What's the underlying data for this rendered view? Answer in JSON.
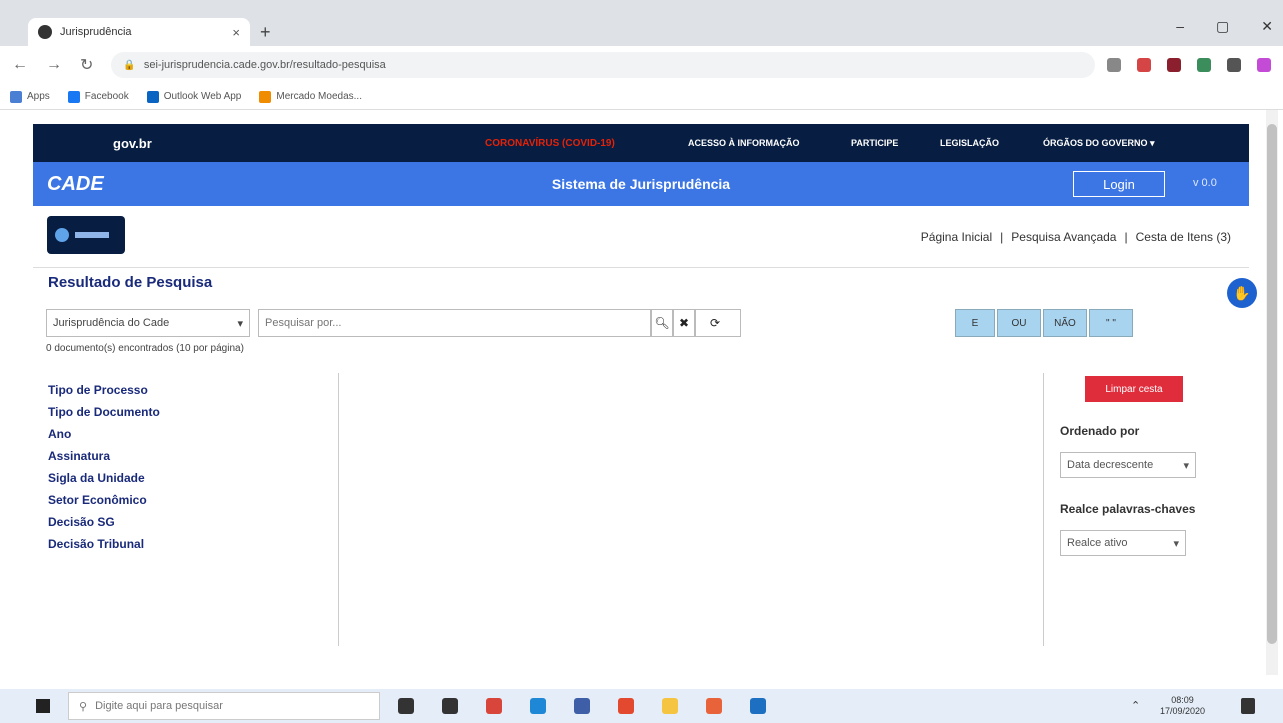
{
  "browser": {
    "tab_title": "Jurisprudência",
    "tab_close": "×",
    "new_tab": "+",
    "window_controls": [
      "–",
      "▢",
      "✕"
    ],
    "url": "sei-jurisprudencia.cade.gov.br/resultado-pesquisa",
    "bookmarks": [
      {
        "label": "Apps",
        "icon": "apps-grid-icon",
        "color": "#4a7fd4"
      },
      {
        "label": "Facebook",
        "icon": "facebook-icon",
        "color": "#1877f2"
      },
      {
        "label": "Outlook Web App",
        "icon": "outlook-icon",
        "color": "#0a64c2"
      },
      {
        "label": "Mercado Moedas...",
        "icon": "bookmark-icon",
        "color": "#f08c00"
      }
    ],
    "extensions": [
      {
        "icon": "star-icon",
        "color": "#888888"
      },
      {
        "icon": "pen-icon",
        "color": "#d64545"
      },
      {
        "icon": "stop-icon",
        "color": "#8b1f2d"
      },
      {
        "icon": "extension-icon",
        "color": "#3b8d5c"
      },
      {
        "icon": "puzzle-icon",
        "color": "#555555"
      },
      {
        "icon": "profile-icon",
        "color": "#c44bd6"
      }
    ]
  },
  "gov_bar": {
    "logo": "gov.br",
    "covid": "CORONAVÍRUS (COVID-19)",
    "links": [
      "ACESSO À INFORMAÇÃO",
      "PARTICIPE",
      "LEGISLAÇÃO",
      "ÓRGÃOS DO GOVERNO"
    ],
    "links_suffix": "▾"
  },
  "cade_bar": {
    "brand": "CADE",
    "system_title": "Sistema de Jurisprudência",
    "login_label": "Login",
    "version": "v 0.0"
  },
  "top_nav": {
    "items": [
      "Página Inicial",
      "Pesquisa Avançada",
      "Cesta de Itens (3)"
    ],
    "separator": "|"
  },
  "results": {
    "title": "Resultado de Pesquisa",
    "collection_selected": "Jurisprudência do Cade",
    "search_placeholder": "Pesquisar por...",
    "count_text": "0 documento(s) encontrados (10 por página)",
    "operator_buttons": [
      "E",
      "OU",
      "NÃO",
      "\" \""
    ]
  },
  "facets": [
    "Tipo de Processo",
    "Tipo de Documento",
    "Ano",
    "Assinatura",
    "Sigla da Unidade",
    "Setor Econômico",
    "Decisão SG",
    "Decisão Tribunal"
  ],
  "sidebar_right": {
    "clear_button": "Limpar cesta",
    "order_label": "Ordenado por",
    "order_selected": "Data decrescente",
    "highlight_label": "Realce palavras-chaves",
    "highlight_selected": "Realce ativo"
  },
  "taskbar": {
    "search_placeholder": "Digite aqui para pesquisar",
    "time": "08:09",
    "date": "17/09/2020",
    "apps": [
      {
        "icon": "cortana-icon",
        "color": "#333333"
      },
      {
        "icon": "task-view-icon",
        "color": "#333333"
      },
      {
        "icon": "chrome-icon",
        "color": "#d8453a"
      },
      {
        "icon": "edge-icon",
        "color": "#1e88d6"
      },
      {
        "icon": "calculator-icon",
        "color": "#3e5ea8"
      },
      {
        "icon": "office-icon",
        "color": "#e2492f"
      },
      {
        "icon": "file-explorer-icon",
        "color": "#f5c542"
      },
      {
        "icon": "firefox-icon",
        "color": "#e8623a"
      },
      {
        "icon": "outlook-icon",
        "color": "#1d6fc2"
      }
    ]
  }
}
